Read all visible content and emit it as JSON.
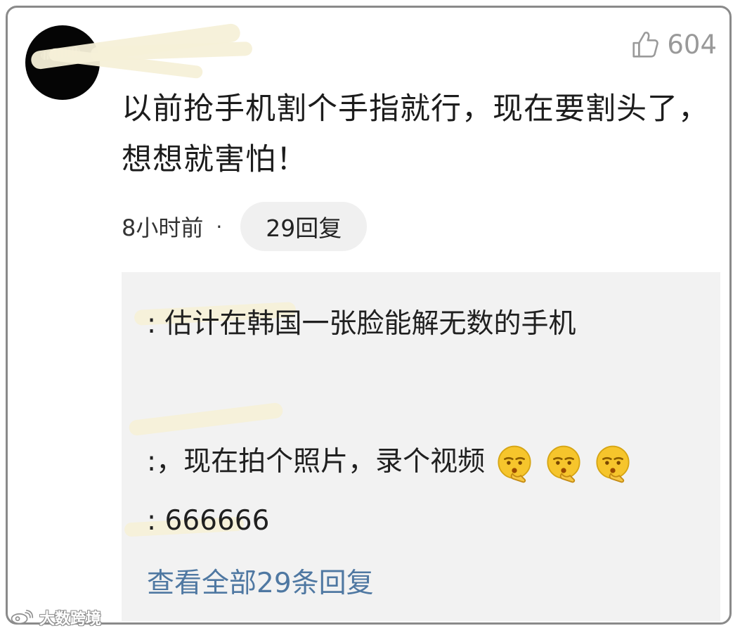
{
  "comment": {
    "like_count": "604",
    "text": "以前抢手机割个手指就行，现在要割头了，想想就害怕！",
    "time": "8小时前",
    "separator": "·",
    "reply_count_label": "29回复"
  },
  "replies": [
    {
      "user": "",
      "text": ": 估计在韩国一张脸能解无数的手机"
    },
    {
      "user": "",
      "text": ":，现在拍个照片，录个视频",
      "emoji_count": 3,
      "emoji_name": "thinking-face-emoji"
    },
    {
      "user": "",
      "text": ": 666666"
    }
  ],
  "replies_footer": {
    "view_all_label": "查看全部29条回复"
  },
  "watermark": {
    "text": "大数跨境"
  },
  "colors": {
    "card_border": "#8a8a8a",
    "reply_background": "#f2f2f2",
    "link": "#4f78a2",
    "username": "#4d5f7f",
    "like_gray": "#999999",
    "redaction": "#f6f0d8"
  },
  "icons": {
    "like": "thumb-up-icon",
    "avatar": "user-avatar",
    "watermark": "weibo-logo-icon"
  }
}
